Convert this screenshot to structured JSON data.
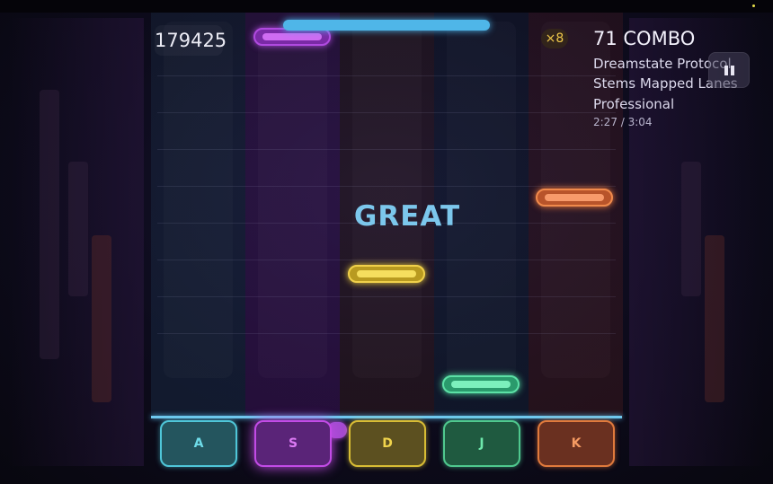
{
  "hud": {
    "score": "179425",
    "multiplier": "×8",
    "combo": "71 COMBO",
    "song_title": "Dreamstate Protocol",
    "song_subtitle": "Stems Mapped Lanes",
    "difficulty": "Professional",
    "time": "2:27 / 3:04",
    "progress_fraction": 0.8
  },
  "judgement": "GREAT",
  "lanes": [
    {
      "key": "A",
      "color": "#4fc6d8"
    },
    {
      "key": "S",
      "color": "#c24be6"
    },
    {
      "key": "D",
      "color": "#e8cc3c"
    },
    {
      "key": "J",
      "color": "#4fe0a0"
    },
    {
      "key": "K",
      "color": "#f07a3c"
    }
  ],
  "notes": [
    {
      "lane": "S",
      "color": "#c24be6"
    },
    {
      "lane": "D",
      "color": "#e8cc3c"
    },
    {
      "lane": "J",
      "color": "#4fe0a0"
    },
    {
      "lane": "K",
      "color": "#f07a3c"
    }
  ],
  "icons": {
    "pause": "pause-icon"
  }
}
